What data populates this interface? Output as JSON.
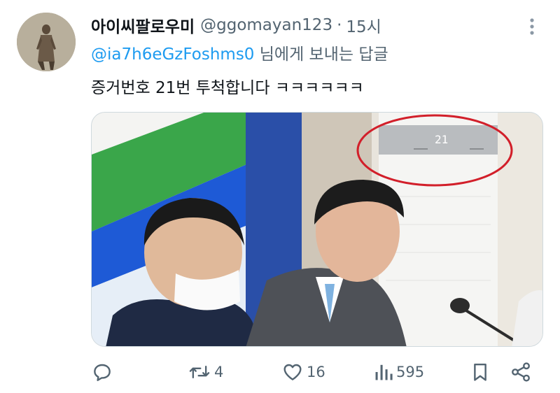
{
  "author": {
    "display_name": "아이씨팔로우미",
    "handle": "@ggomayan123",
    "separator": "·",
    "time": "15시"
  },
  "reply": {
    "mention": "@ia7h6eGzFoshms0",
    "suffix": " 님에게 보내는 답글"
  },
  "tweet": {
    "text": "증거번호 21번 투척합니다 ㅋㅋㅋㅋㅋㅋ"
  },
  "media": {
    "display_reading": "21",
    "highlight_color": "#d21f2a"
  },
  "actions": {
    "reply_count": "",
    "retweet_count": "4",
    "like_count": "16",
    "view_count": "595"
  },
  "colors": {
    "text_primary": "#0f1419",
    "text_secondary": "#536471",
    "link": "#1d9bf0"
  }
}
